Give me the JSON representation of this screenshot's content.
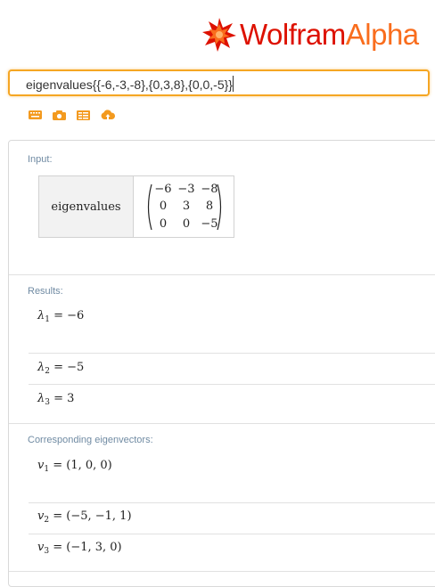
{
  "logo": {
    "text_wolfram": "Wolfram",
    "text_alpha": "Alpha",
    "brand_red": "#dd1100",
    "brand_orange": "#f96d1d"
  },
  "search": {
    "value": "eigenvalues{{-6,-3,-8},{0,3,8},{0,0,-5}}"
  },
  "toolbar": {
    "icons": [
      "keyboard-icon",
      "camera-icon",
      "table-icon",
      "cloud-upload-icon"
    ]
  },
  "input_pod": {
    "title": "Input:",
    "label": "eigenvalues",
    "matrix": [
      [
        "−6",
        "−3",
        "−8"
      ],
      [
        "0",
        "3",
        "8"
      ],
      [
        "0",
        "0",
        "−5"
      ]
    ]
  },
  "results_pod": {
    "title": "Results:",
    "items": [
      {
        "symbol": "λ",
        "index": "1",
        "eq": " = −6"
      },
      {
        "symbol": "λ",
        "index": "2",
        "eq": " = −5"
      },
      {
        "symbol": "λ",
        "index": "3",
        "eq": " = 3"
      }
    ]
  },
  "eigenvectors_pod": {
    "title": "Corresponding eigenvectors:",
    "items": [
      {
        "symbol": "v",
        "index": "1",
        "eq": " = (1, 0, 0)"
      },
      {
        "symbol": "v",
        "index": "2",
        "eq": " = (−5, −1, 1)"
      },
      {
        "symbol": "v",
        "index": "3",
        "eq": " = (−1, 3, 0)"
      }
    ]
  }
}
